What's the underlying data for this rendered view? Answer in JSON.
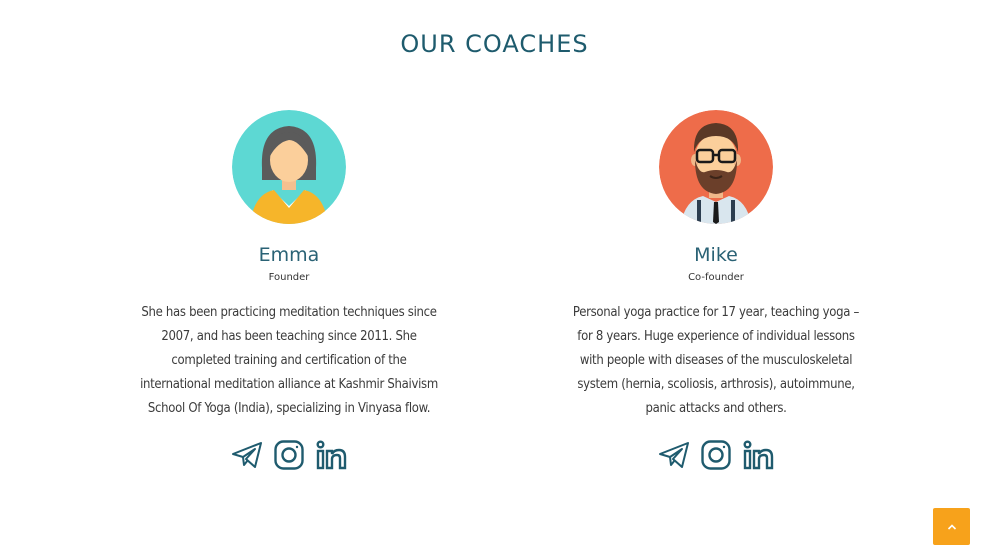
{
  "section": {
    "title": "OUR COACHES"
  },
  "coaches": [
    {
      "name": "Emma",
      "role": "Founder",
      "bio": "She has been practicing meditation techniques since 2007, and has been teaching since 2011. She completed training and certification of the international meditation alliance at Kashmir Shaivism School Of Yoga (India), specializing in Vinyasa flow.",
      "avatar_bg": "#5dd8d3",
      "social_icons": [
        "telegram-icon",
        "instagram-icon",
        "linkedin-icon"
      ]
    },
    {
      "name": "Mike",
      "role": "Co-founder",
      "bio": "Personal yoga practice for 17 year, teaching yoga – for 8 years. Huge experience of individual lessons with people with diseases of the musculoskeletal system (hernia, scoliosis, arthrosis), autoimmune, panic attacks and others.",
      "avatar_bg": "#ee6c4a",
      "social_icons": [
        "telegram-icon",
        "instagram-icon",
        "linkedin-icon"
      ]
    }
  ],
  "colors": {
    "heading": "#1e5b6d",
    "icon": "#1f5b6e",
    "scroll_button": "#f7a21b"
  },
  "scroll_top": {
    "icon": "chevron-up-icon"
  }
}
